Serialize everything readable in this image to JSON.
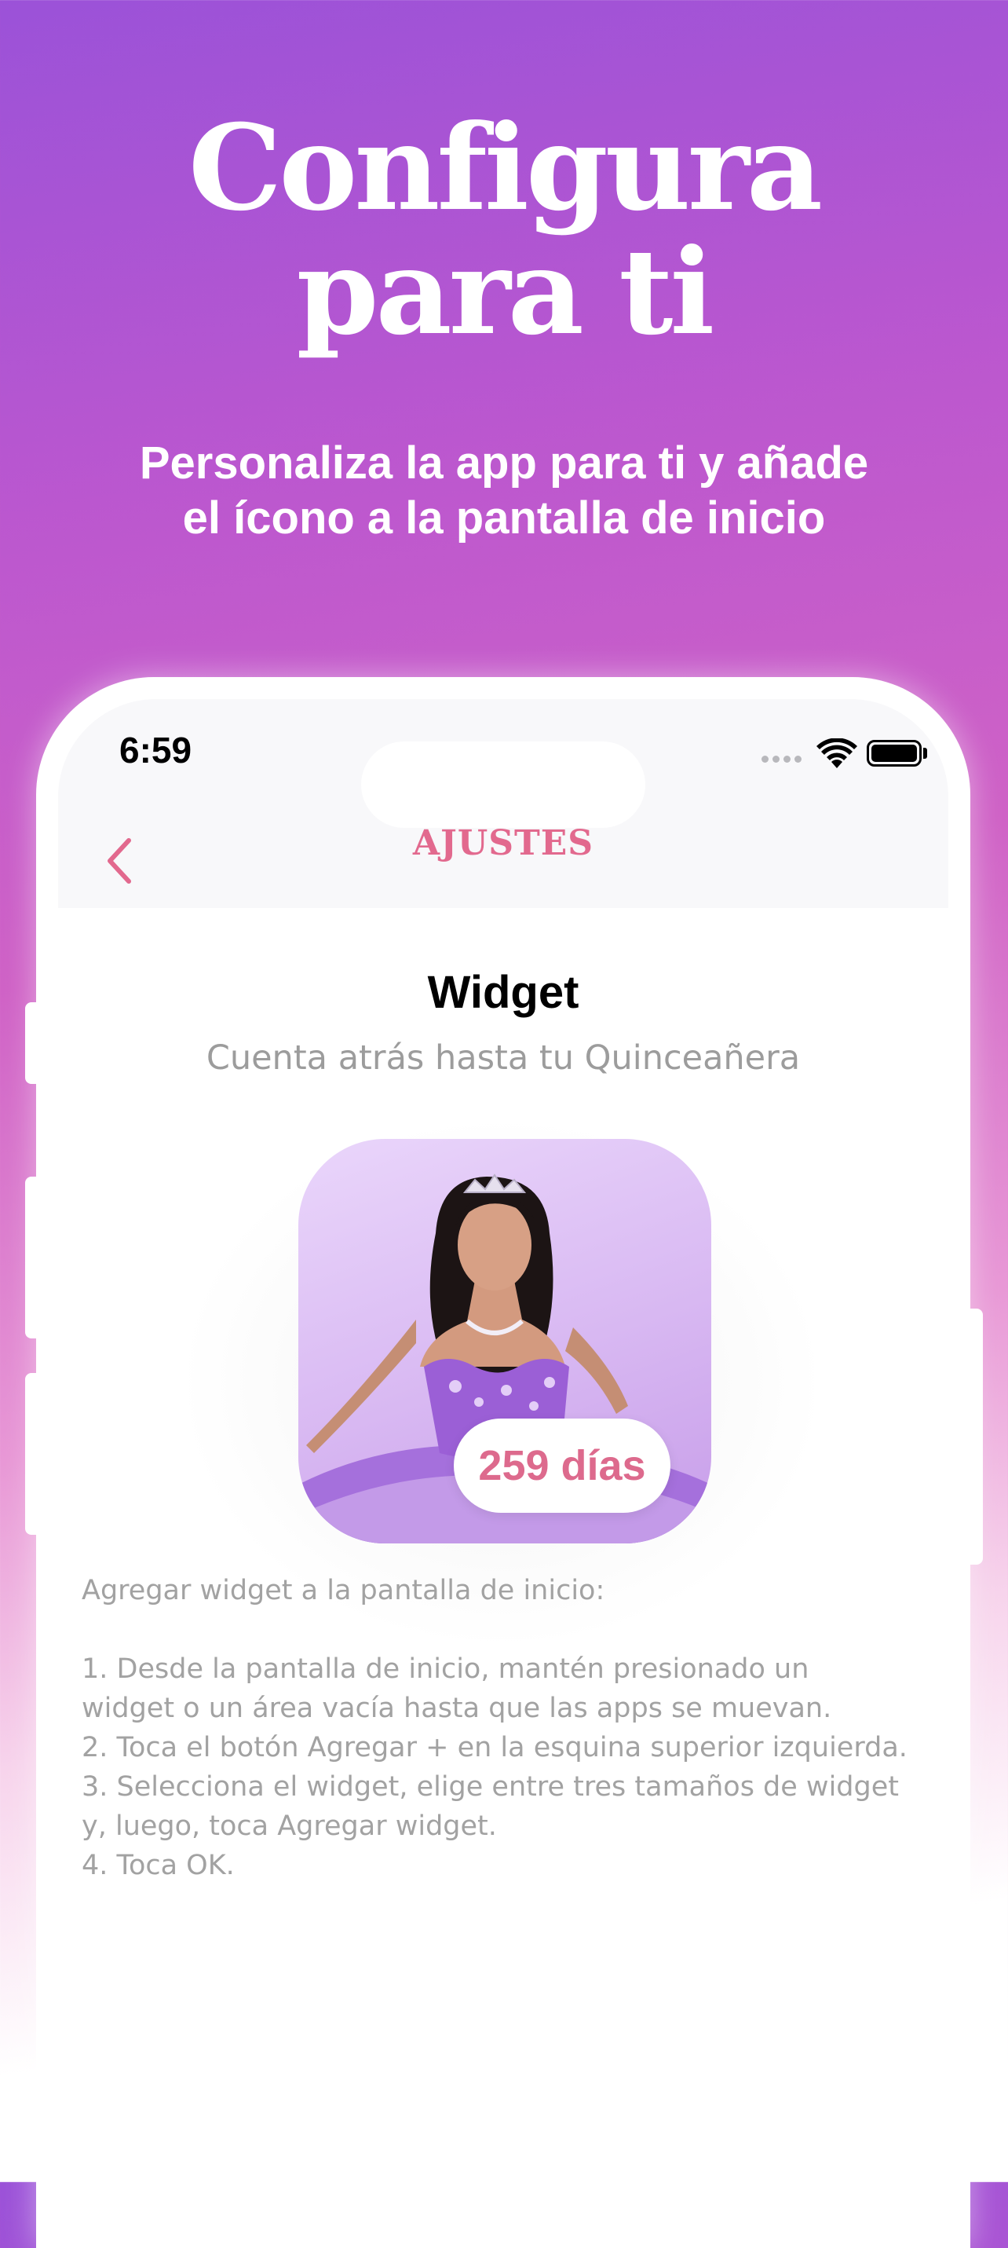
{
  "headline": {
    "line1": "Configura",
    "line2": "para ti"
  },
  "subheadline": {
    "line1": "Personaliza la app para ti y añade",
    "line2": "el ícono a la pantalla de inicio"
  },
  "status_bar": {
    "time": "6:59"
  },
  "nav": {
    "title": "AJUSTES",
    "back_icon": "chevron-left-icon"
  },
  "content": {
    "title": "Widget",
    "subtitle": "Cuenta atrás hasta tu Quinceañera"
  },
  "widget": {
    "days_label": "259 días"
  },
  "instructions": {
    "heading": "Agregar widget a la pantalla de inicio:",
    "steps": [
      "1. Desde la pantalla de inicio, mantén presionado un widget o un área vacía hasta que las apps se muevan.",
      "2. Toca el botón Agregar + en la esquina superior izquierda.",
      "3. Selecciona el widget, elige entre tres tamaños de widget y, luego, toca Agregar widget.",
      "4. Toca OK."
    ]
  },
  "colors": {
    "accent": "#e2698e",
    "background_top": "#9b52d8",
    "background_mid": "#cf62c6"
  }
}
